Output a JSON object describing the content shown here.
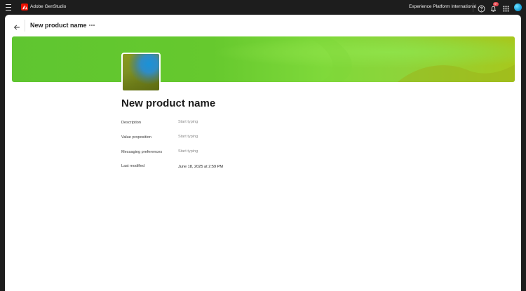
{
  "topbar": {
    "app_name": "Adobe GenStudio",
    "org_name": "Experience Platform International",
    "notification_badge": "9+",
    "icons": [
      "menu-icon",
      "adobe-logo-icon",
      "help-icon",
      "bell-icon",
      "apps-grid-icon",
      "avatar"
    ]
  },
  "header": {
    "title": "New product name"
  },
  "product": {
    "name": "New product name",
    "fields": [
      {
        "label": "Description",
        "placeholder": "Start typing"
      },
      {
        "label": "Value proposition",
        "placeholder": "Start typing"
      },
      {
        "label": "Messaging preferences",
        "placeholder": "Start typing"
      },
      {
        "label": "Last modified",
        "value": "June 18, 2025 at 2:59 PM"
      }
    ]
  },
  "colors": {
    "topbar_bg": "#1d1d1d",
    "banner_green": "#66c92e",
    "badge_red": "#e34850",
    "adobe_red": "#eb1000"
  }
}
